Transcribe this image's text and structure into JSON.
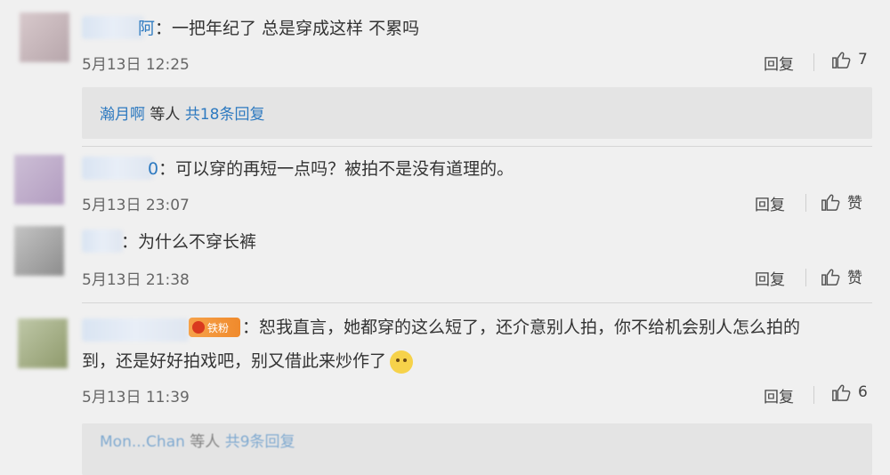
{
  "comments": [
    {
      "name_suffix": "阿",
      "text": "：一把年纪了 总是穿成这样 不累吗",
      "time": "5月13日 12:25",
      "reply_label": "回复",
      "like_count": "7",
      "sub": {
        "names": "瀚月啊",
        "others": "等人",
        "total": "共18条回复"
      }
    },
    {
      "name_suffix": "0",
      "text": "：可以穿的再短一点吗？被拍不是没有道理的。",
      "time": "5月13日 23:07",
      "reply_label": "回复",
      "like_count": "赞"
    },
    {
      "name_suffix": "",
      "text": "：为什么不穿长裤",
      "time": "5月13日 21:38",
      "reply_label": "回复",
      "like_count": "赞"
    },
    {
      "badge": "铁粉",
      "text_line1": "：恕我直言，她都穿的这么短了，还介意别人拍，你不给机会别人怎么拍的",
      "text_line2": "到，还是好好拍戏吧，别又借此来炒作了",
      "time": "5月13日 11:39",
      "reply_label": "回复",
      "like_count": "6",
      "sub": {
        "names": "Mon...Chan",
        "others": "等人",
        "total": "共9条回复"
      }
    }
  ],
  "icons": {
    "like": "thumbs-up-icon",
    "emoji": "doge-emoji-icon",
    "fan_medal": "fan-medal-icon"
  },
  "colors": {
    "link_blue": "#2e7ac0",
    "badge_orange": "#f08a2c"
  }
}
